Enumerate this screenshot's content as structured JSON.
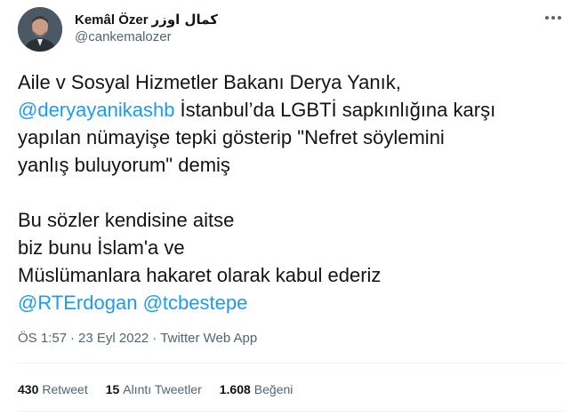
{
  "author": {
    "display_name": "Kemâl Özer",
    "display_name_ar": "كمال اوزر",
    "handle": "@cankemalozer"
  },
  "tweet": {
    "lines": [
      [
        {
          "text": "Aile v Sosyal Hizmetler Bakanı Derya Yanık,",
          "mention": false
        }
      ],
      [
        {
          "text": "@deryayanikashb",
          "mention": true
        },
        {
          "text": " İstanbul’da LGBTİ sapkınlığına karşı",
          "mention": false
        }
      ],
      [
        {
          "text": "yapılan nümayişe tepki gösterip \"Nefret söylemini",
          "mention": false
        }
      ],
      [
        {
          "text": "yanlış buluyorum\" demiş",
          "mention": false
        }
      ],
      [],
      [
        {
          "text": "Bu sözler kendisine aitse",
          "mention": false
        }
      ],
      [
        {
          "text": "biz bunu İslam'a ve",
          "mention": false
        }
      ],
      [
        {
          "text": "Müslümanlara hakaret olarak kabul ederiz",
          "mention": false
        }
      ],
      [
        {
          "text": "@RTErdogan",
          "mention": true
        },
        {
          "text": " ",
          "mention": false
        },
        {
          "text": "@tcbestepe",
          "mention": true
        }
      ]
    ]
  },
  "meta": {
    "time": "ÖS 1:57",
    "separator": "·",
    "date": "23 Eyl 2022",
    "source": "Twitter Web App"
  },
  "stats": [
    {
      "count": "430",
      "label": "Retweet",
      "name": "retweets"
    },
    {
      "count": "15",
      "label": "Alıntı Tweetler",
      "name": "quote-tweets"
    },
    {
      "count": "1.608",
      "label": "Beğeni",
      "name": "likes"
    }
  ],
  "colors": {
    "text": "#0f1419",
    "secondary": "#536471",
    "link": "#1d9bf0",
    "divider": "#eff3f4"
  },
  "icons": {
    "more": "more-horizontal-icon"
  }
}
